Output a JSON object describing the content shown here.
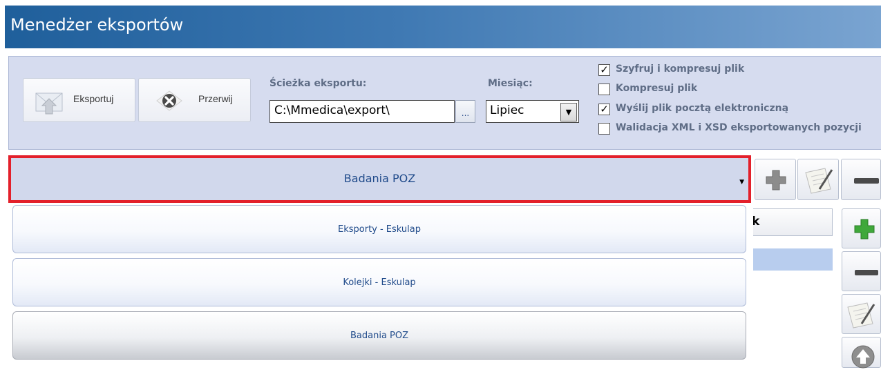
{
  "window": {
    "title": "Menedżer eksportów"
  },
  "toolbar": {
    "export_label": "Eksportuj",
    "stop_label": "Przerwij",
    "path_label": "Ścieżka eksportu:",
    "path_value": "C:\\Mmedica\\export\\",
    "browse_label": "...",
    "month_label": "Miesiąc:",
    "month_value": "Lipiec"
  },
  "options": [
    {
      "label": "Szyfruj i kompresuj plik",
      "checked": true
    },
    {
      "label": "Kompresuj plik",
      "checked": false
    },
    {
      "label": "Wyślij plik pocztą elektroniczną",
      "checked": true
    },
    {
      "label": "Walidacja XML i XSD eksportowanych pozycji",
      "checked": false
    }
  ],
  "export_selector": {
    "selected": "Badania POZ",
    "items": [
      {
        "label": "Eksporty - Eskulap"
      },
      {
        "label": "Kolejki - Eskulap"
      },
      {
        "label": "Badania POZ"
      }
    ]
  },
  "grid": {
    "column_header_fragment": "k"
  },
  "icons": {
    "export": "envelope-upload-icon",
    "stop": "x-cross-icon",
    "add": "plus-icon",
    "edit": "notepad-edit-icon",
    "remove": "minus-icon",
    "up": "arrow-up-icon"
  },
  "colors": {
    "title_bar": "#2b6aa5",
    "highlight_border": "#e3202b",
    "label_text": "#5f6d86",
    "link_text": "#1f4a8a",
    "add_green": "#3fa83a"
  }
}
